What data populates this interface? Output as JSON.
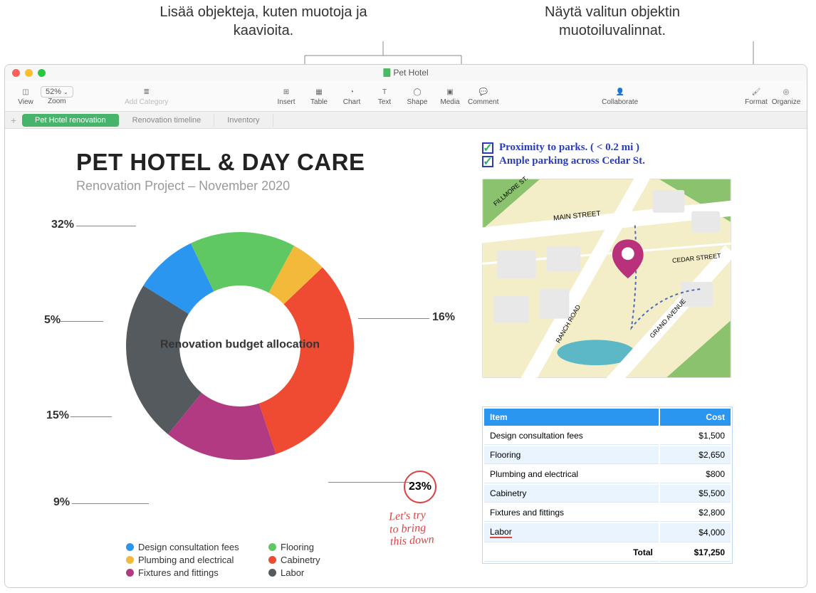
{
  "callouts": {
    "insert": "Lisää objekteja, kuten muotoja ja kaavioita.",
    "format": "Näytä valitun objektin muotoiluvalinnat."
  },
  "window": {
    "title": "Pet Hotel"
  },
  "toolbar": {
    "view": "View",
    "zoom_value": "52%",
    "zoom_label": "Zoom",
    "add_category": "Add Category",
    "insert": "Insert",
    "table": "Table",
    "chart": "Chart",
    "text": "Text",
    "shape": "Shape",
    "media": "Media",
    "comment": "Comment",
    "collaborate": "Collaborate",
    "format": "Format",
    "organize": "Organize"
  },
  "tabs": {
    "t1": "Pet Hotel renovation",
    "t2": "Renovation timeline",
    "t3": "Inventory"
  },
  "doc": {
    "title": "PET HOTEL & DAY CARE",
    "subtitle": "Renovation Project – November 2020",
    "chart_title": "Renovation budget allocation"
  },
  "notes": {
    "n1": "Proximity to parks. ( < 0.2 mi )",
    "n2": "Ample parking across  Cedar St."
  },
  "map_streets": {
    "fillmore": "FILLMORE ST.",
    "main": "MAIN STREET",
    "cedar": "CEDAR STREET",
    "ranch": "RANCH ROAD",
    "grand": "GRAND AVENUE"
  },
  "annotations": {
    "circled_pct": "23%",
    "handnote_l1": "Let's try",
    "handnote_l2": "to bring",
    "handnote_l3": "this down"
  },
  "table": {
    "h_item": "Item",
    "h_cost": "Cost",
    "rows": [
      {
        "item": "Design consultation fees",
        "cost": "$1,500"
      },
      {
        "item": "Flooring",
        "cost": "$2,650"
      },
      {
        "item": "Plumbing and electrical",
        "cost": "$800"
      },
      {
        "item": "Cabinetry",
        "cost": "$5,500"
      },
      {
        "item": "Fixtures and fittings",
        "cost": "$2,800"
      },
      {
        "item": "Labor",
        "cost": "$4,000"
      }
    ],
    "total_label": "Total",
    "total_value": "$17,250"
  },
  "chart_data": {
    "type": "pie",
    "title": "Renovation budget allocation",
    "series": [
      {
        "name": "Design consultation fees",
        "value": 9,
        "color": "#2a96f0"
      },
      {
        "name": "Flooring",
        "value": 15,
        "color": "#5fc862"
      },
      {
        "name": "Plumbing and electrical",
        "value": 5,
        "color": "#f3b93a"
      },
      {
        "name": "Cabinetry",
        "value": 32,
        "color": "#ef4a32"
      },
      {
        "name": "Fixtures and fittings",
        "value": 16,
        "color": "#b23a83"
      },
      {
        "name": "Labor",
        "value": 23,
        "color": "#555a5e"
      }
    ],
    "label_positions": {
      "p32": "32%",
      "p5": "5%",
      "p15": "15%",
      "p9": "9%",
      "p16": "16%",
      "p23": "23%"
    }
  }
}
